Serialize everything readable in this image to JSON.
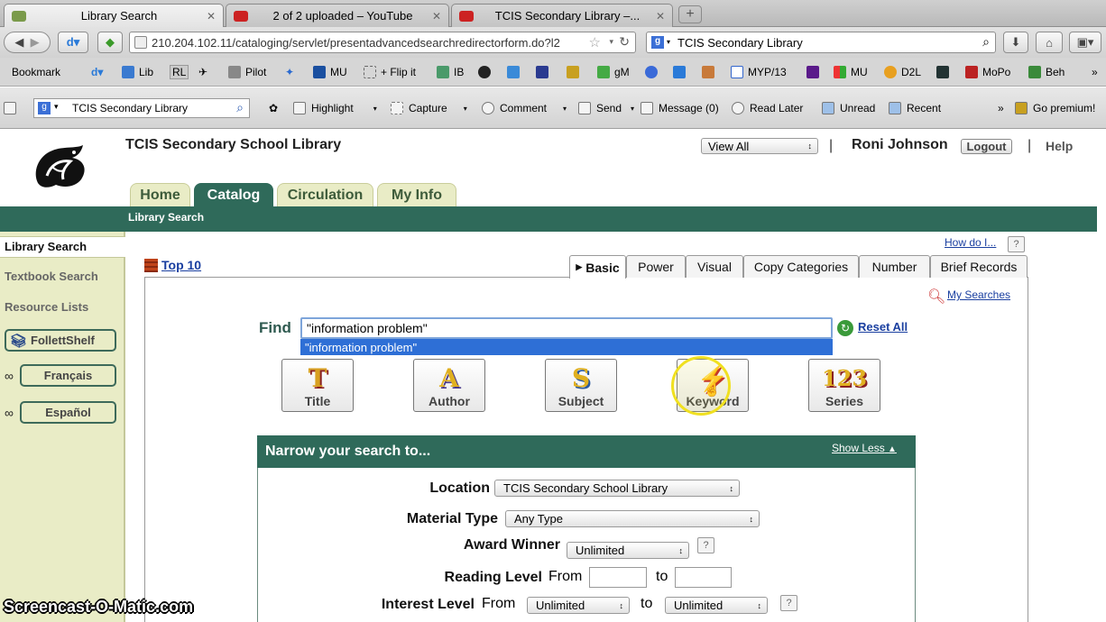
{
  "browser": {
    "tabs": [
      {
        "label": "Library Search",
        "active": true,
        "favicon_color": "#7a9a4a"
      },
      {
        "label": "2 of 2 uploaded – YouTube",
        "active": false,
        "favicon_color": "#cc2222"
      },
      {
        "label": "TCIS Secondary Library –...",
        "active": false,
        "favicon_color": "#cc2222"
      }
    ],
    "new_tab_label": "+",
    "url": "210.204.102.11/cataloging/servlet/presentadvancedsearchredirectorform.do?l2",
    "search_value": "TCIS Secondary Library",
    "bookmarks": [
      "Bookmark",
      "Lib",
      "RL",
      "Pilot",
      "MU",
      "+ Flip it",
      "IB",
      "gM",
      "MYP/13",
      "MU",
      "D2L",
      "MoPo",
      "Beh"
    ],
    "toolbar": {
      "search_value": "TCIS Secondary Library",
      "items": [
        "Highlight",
        "Capture",
        "Comment",
        "Send",
        "Message (0)",
        "Read Later",
        "Unread",
        "Recent",
        "Go premium!"
      ]
    }
  },
  "site": {
    "title": "TCIS Secondary School Library",
    "view_select": "View All",
    "user_name": "Roni Johnson",
    "logout_label": "Logout",
    "help_label": "Help",
    "separator": "|",
    "main_tabs": [
      {
        "label": "Home"
      },
      {
        "label": "Catalog",
        "active": true
      },
      {
        "label": "Circulation"
      },
      {
        "label": "My Info"
      }
    ],
    "subnav": "Library Search"
  },
  "sidebar": {
    "items": [
      "Library Search",
      "Textbook Search",
      "Resource Lists"
    ],
    "buttons": [
      "FollettShelf",
      "Français",
      "Español"
    ]
  },
  "search": {
    "howdoi": "How do I...",
    "top10": "Top 10",
    "tabs": [
      "Basic",
      "Power",
      "Visual",
      "Copy Categories",
      "Number",
      "Brief Records"
    ],
    "my_searches": "My Searches",
    "find_label": "Find",
    "find_value": "\"information problem\"",
    "suggestion": "\"information problem\"",
    "reset_all": "Reset All",
    "buttons": [
      {
        "label": "Title",
        "glyph": "T"
      },
      {
        "label": "Author",
        "glyph": "A"
      },
      {
        "label": "Subject",
        "glyph": "S"
      },
      {
        "label": "Keyword",
        "glyph": "⚡"
      },
      {
        "label": "Series",
        "glyph": "123"
      }
    ]
  },
  "narrow": {
    "heading": "Narrow your search to...",
    "show_less": "Show Less",
    "location_label": "Location",
    "location_value": "TCIS Secondary School Library",
    "material_label": "Material Type",
    "material_value": "Any Type",
    "award_label": "Award Winner",
    "award_value": "Unlimited",
    "reading_label": "Reading Level",
    "from_label": "From",
    "to_label": "to",
    "interest_label": "Interest Level",
    "interest_from": "Unlimited",
    "interest_to": "Unlimited",
    "help_mark": "?"
  },
  "watermark": "Screencast-O-Matic.com"
}
